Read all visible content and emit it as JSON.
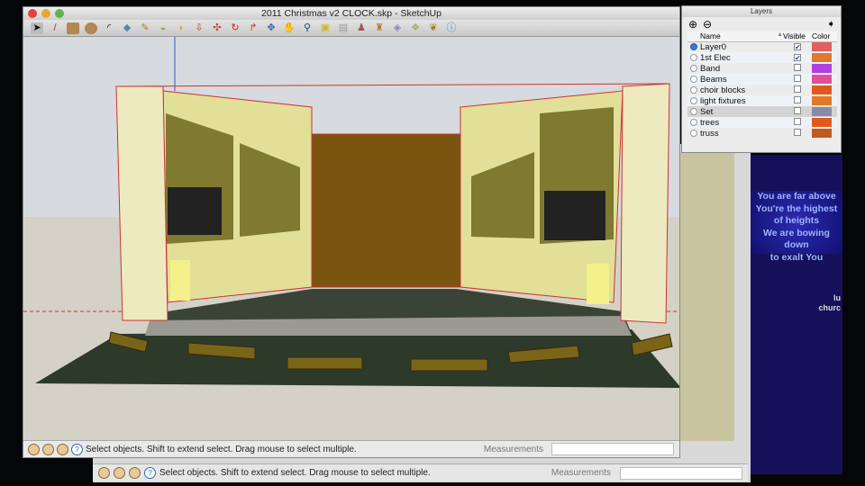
{
  "window": {
    "title": "2011 Christmas v2 CLOCK.skp - SketchUp"
  },
  "status": {
    "text": "Select objects. Shift to extend select. Drag mouse to select multiple.",
    "measurements_label": "Measurements",
    "measurements_value": ""
  },
  "back_window": {
    "status_text": "Select objects. Shift to extend select. Drag mouse to select multiple.",
    "measurements_label": "Measurements"
  },
  "layers": {
    "title": "Layers",
    "columns": {
      "name": "Name",
      "visible": "Visible",
      "color": "Color"
    },
    "items": [
      {
        "name": "Layer0",
        "active": true,
        "visible": true,
        "color": "#e06060"
      },
      {
        "name": "1st Elec",
        "active": false,
        "visible": true,
        "color": "#e07a2a"
      },
      {
        "name": "Band",
        "active": false,
        "visible": false,
        "color": "#b040e0"
      },
      {
        "name": "Beams",
        "active": false,
        "visible": false,
        "color": "#e0509a"
      },
      {
        "name": "choir blocks",
        "active": false,
        "visible": false,
        "color": "#e05a20"
      },
      {
        "name": "light fixtures",
        "active": false,
        "visible": false,
        "color": "#e07a28"
      },
      {
        "name": "Set",
        "active": false,
        "visible": false,
        "color": "#8a8aa8"
      },
      {
        "name": "trees",
        "active": false,
        "visible": false,
        "color": "#e05a20"
      },
      {
        "name": "truss",
        "active": false,
        "visible": false,
        "color": "#c05a20"
      }
    ]
  },
  "projection": {
    "lyrics": [
      "You are far above",
      "You're the highest",
      "of heights",
      "We are bowing down",
      "to exalt You"
    ],
    "sub": [
      "lu",
      "churc"
    ]
  }
}
